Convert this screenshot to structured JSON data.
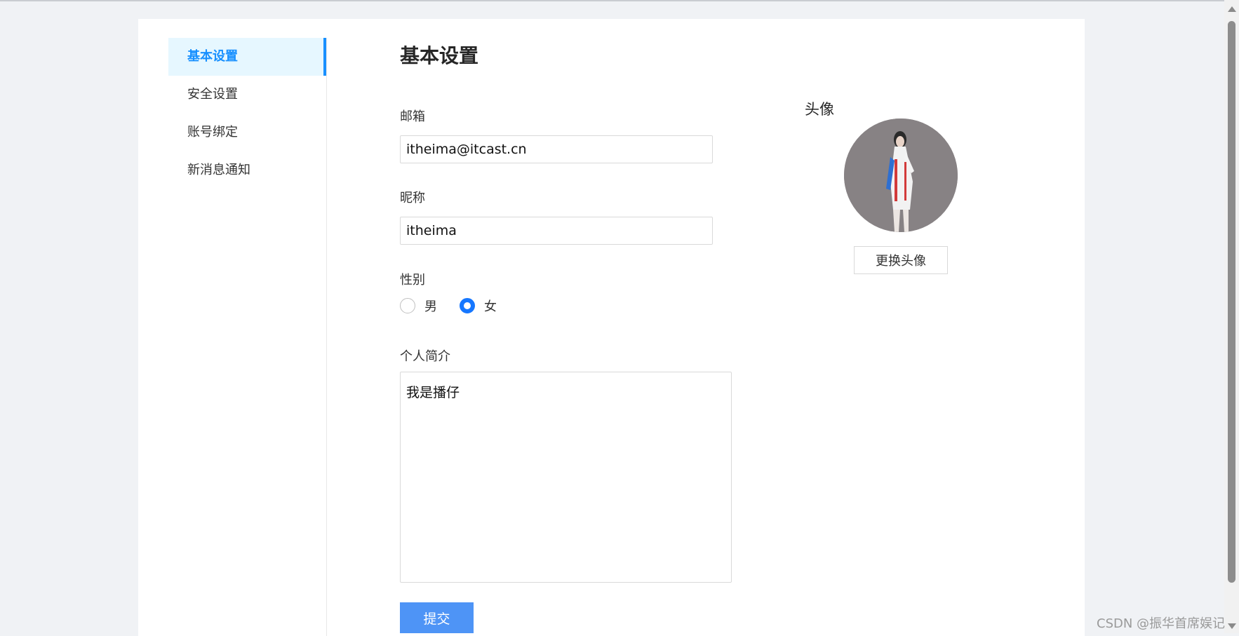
{
  "sidebar": {
    "items": [
      {
        "label": "基本设置",
        "active": true
      },
      {
        "label": "安全设置",
        "active": false
      },
      {
        "label": "账号绑定",
        "active": false
      },
      {
        "label": "新消息通知",
        "active": false
      }
    ]
  },
  "form": {
    "title": "基本设置",
    "email": {
      "label": "邮箱",
      "value": "itheima@itcast.cn"
    },
    "nickname": {
      "label": "昵称",
      "value": "itheima"
    },
    "gender": {
      "label": "性别",
      "options": [
        {
          "label": "男",
          "checked": false
        },
        {
          "label": "女",
          "checked": true
        }
      ]
    },
    "bio": {
      "label": "个人简介",
      "value": "我是播仔"
    },
    "submit_label": "提交"
  },
  "avatar": {
    "title": "头像",
    "change_label": "更换头像"
  },
  "watermark": "CSDN @振华首席娱记",
  "colors": {
    "accent": "#1890ff",
    "submit": "#4e94f6",
    "page_bg": "#f0f2f5"
  }
}
